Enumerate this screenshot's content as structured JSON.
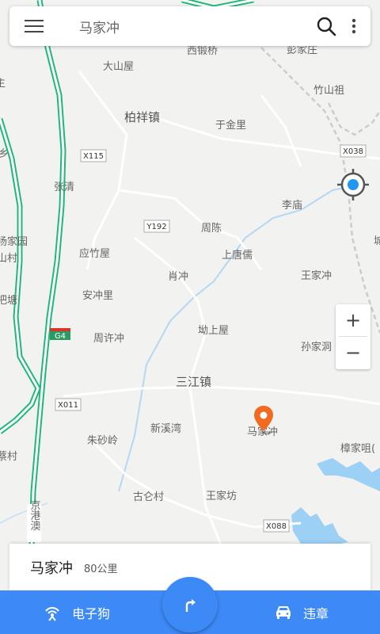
{
  "search": {
    "text": "马家冲"
  },
  "map": {
    "labels": {
      "xiduanqiao": "西锻桥",
      "pengjiazhuang": "彭家庄",
      "dashanwu": "大山屋",
      "zhushanzu": "竹山祖",
      "baixiangzhen": "柏祥镇",
      "yujinli": "于金里",
      "zhangqing": "张清",
      "limiao": "李庙",
      "zhouchen": "周陈",
      "yingzhuwu": "应竹屋",
      "shangtangru": "上唐儒",
      "xiaochong": "肖冲",
      "wangjiachong": "王家冲",
      "anchongli": "安冲里",
      "zhouxuchong": "周许冲",
      "aoshangwu": "坳上屋",
      "sunjiadong": "孙家洞",
      "sanjiangzhen": "三江镇",
      "xinxiwan": "新溪湾",
      "majiachong": "马家冲",
      "zhushaling": "朱砂岭",
      "zhangjiaju": "樟家咀(",
      "guluncun": "古仑村",
      "wangjiafang": "王家坊",
      "yangjiayuan": "扬家园",
      "shancun": "山村",
      "bantang": "把塘",
      "xiang": "乡",
      "zhu": "主",
      "caicun": "蔡村",
      "jinggangao": "京港澳",
      "cheng": "城"
    },
    "roads": {
      "x115": "X115",
      "x038": "X038",
      "y192": "Y192",
      "g4": "G4",
      "x011": "X011",
      "x088": "X088"
    }
  },
  "controls": {
    "zoom_in": "+",
    "zoom_out": "−"
  },
  "info_card": {
    "name": "马家冲",
    "distance": "80公里"
  },
  "bottom_bar": {
    "left_label": "电子狗",
    "right_label": "违章"
  },
  "colors": {
    "accent": "#3d8af7",
    "pin": "#f26a22",
    "highway": "#1fb87a",
    "water": "#9dd0f5"
  }
}
